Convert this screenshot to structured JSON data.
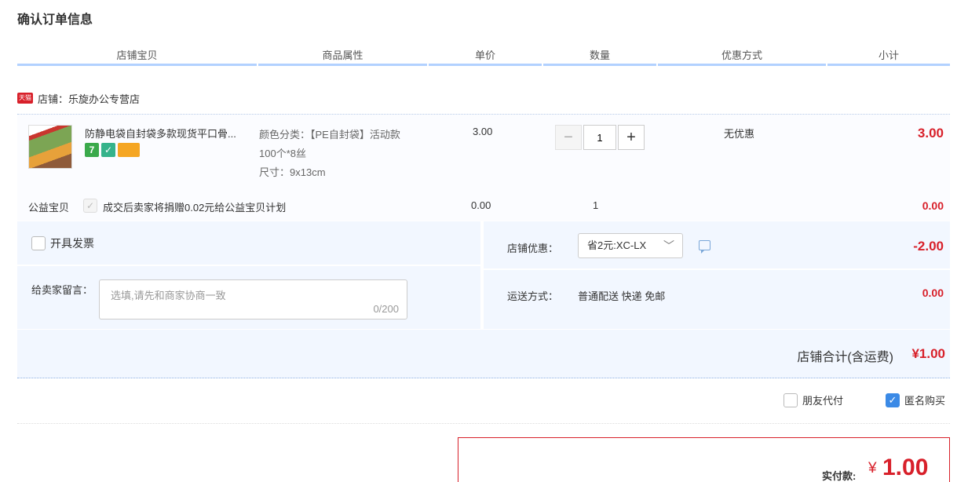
{
  "page": {
    "title": "确认订单信息"
  },
  "columns": [
    "店铺宝贝",
    "商品属性",
    "单价",
    "数量",
    "优惠方式",
    "小计"
  ],
  "shop": {
    "badge": "天猫",
    "label": "店铺：乐旋办公专营店"
  },
  "item": {
    "title": "防静电袋自封袋多款现货平口骨...",
    "properties": [
      "颜色分类：【PE自封袋】活动款",
      "100个*8丝",
      "尺寸：9x13cm"
    ],
    "unit_price": "3.00",
    "quantity": "1",
    "minus": "−",
    "plus": "+",
    "discount": "无优惠",
    "subtotal": "3.00",
    "service_icons": [
      "7",
      "✓",
      ""
    ]
  },
  "charity": {
    "label": "公益宝贝",
    "checkmark": "✓",
    "text": "成交后卖家将捐赠0.02元给公益宝贝计划",
    "price": "0.00",
    "quantity": "1",
    "subtotal": "0.00"
  },
  "invoice": {
    "label": "开具发票"
  },
  "message": {
    "label": "给卖家留言：",
    "placeholder": "选填,请先和商家协商一致",
    "counter": "0/200"
  },
  "shop_discount": {
    "label": "店铺优惠：",
    "selected": "省2元:XC-LX",
    "amount": "-2.00"
  },
  "shipping": {
    "label": "运送方式：",
    "method": "普通配送 快递 免邮",
    "amount": "0.00"
  },
  "total": {
    "label": "店铺合计(含运费)",
    "amount": "¥1.00"
  },
  "options": {
    "friend_pay": "朋友代付",
    "anonymous": "匿名购买",
    "anonymous_check": "✓"
  },
  "payment": {
    "label": "实付款:",
    "currency": "¥",
    "amount": "1.00"
  },
  "colors": {
    "price_red": "#d8202a",
    "header_line": "#b2d1ff",
    "panel_bg": "#f2f7ff",
    "check_blue": "#3b8ae6"
  }
}
